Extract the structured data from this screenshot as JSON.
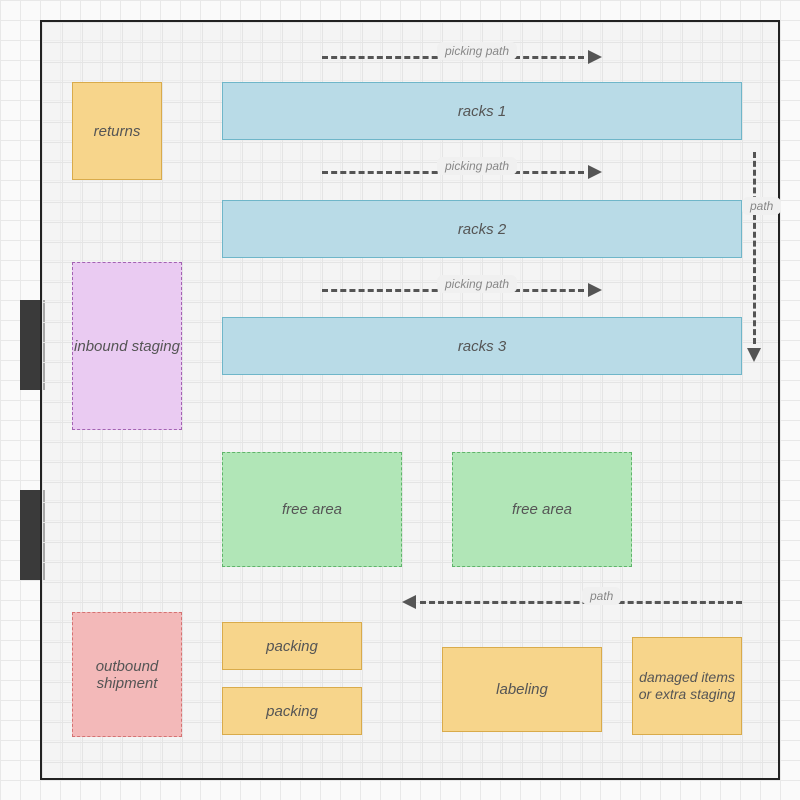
{
  "zones": {
    "returns": "returns",
    "racks1": "racks 1",
    "racks2": "racks 2",
    "racks3": "racks 3",
    "inbound": "inbound staging",
    "free1": "free area",
    "free2": "free area",
    "outbound": "outbound shipment",
    "packing1": "packing",
    "packing2": "packing",
    "labeling": "labeling",
    "damaged": "damaged items or extra staging"
  },
  "paths": {
    "picking1": "picking path",
    "picking2": "picking path",
    "picking3": "picking path",
    "vertical": "path",
    "bottom": "path"
  }
}
